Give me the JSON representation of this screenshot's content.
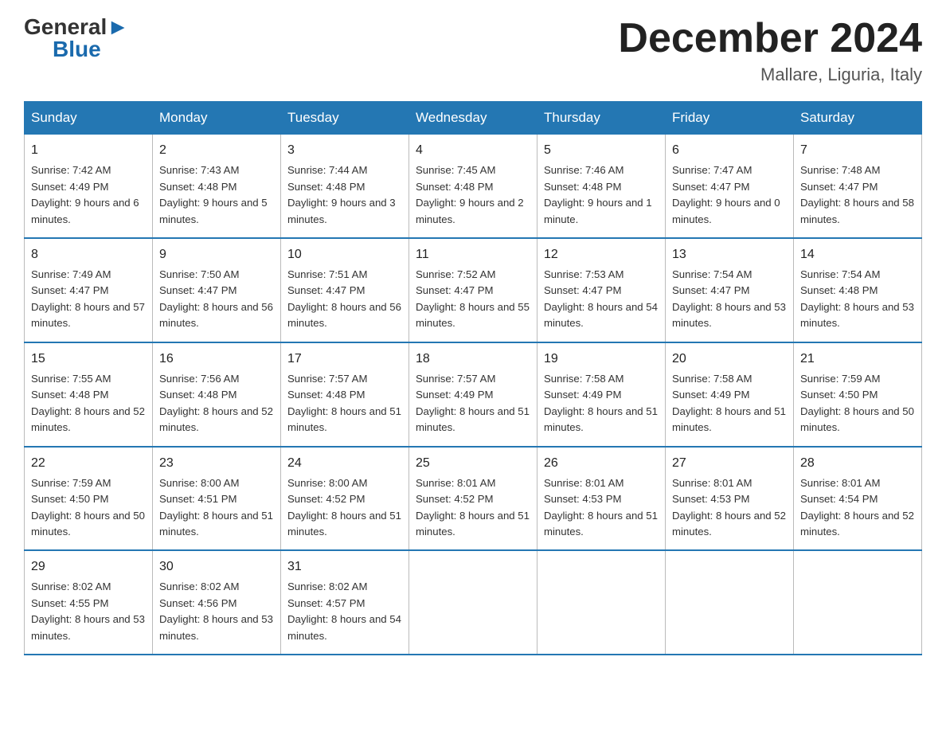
{
  "header": {
    "logo_general": "General",
    "logo_blue": "Blue",
    "month_title": "December 2024",
    "location": "Mallare, Liguria, Italy"
  },
  "days_of_week": [
    "Sunday",
    "Monday",
    "Tuesday",
    "Wednesday",
    "Thursday",
    "Friday",
    "Saturday"
  ],
  "weeks": [
    [
      {
        "day": "1",
        "sunrise": "7:42 AM",
        "sunset": "4:49 PM",
        "daylight": "9 hours and 6 minutes."
      },
      {
        "day": "2",
        "sunrise": "7:43 AM",
        "sunset": "4:48 PM",
        "daylight": "9 hours and 5 minutes."
      },
      {
        "day": "3",
        "sunrise": "7:44 AM",
        "sunset": "4:48 PM",
        "daylight": "9 hours and 3 minutes."
      },
      {
        "day": "4",
        "sunrise": "7:45 AM",
        "sunset": "4:48 PM",
        "daylight": "9 hours and 2 minutes."
      },
      {
        "day": "5",
        "sunrise": "7:46 AM",
        "sunset": "4:48 PM",
        "daylight": "9 hours and 1 minute."
      },
      {
        "day": "6",
        "sunrise": "7:47 AM",
        "sunset": "4:47 PM",
        "daylight": "9 hours and 0 minutes."
      },
      {
        "day": "7",
        "sunrise": "7:48 AM",
        "sunset": "4:47 PM",
        "daylight": "8 hours and 58 minutes."
      }
    ],
    [
      {
        "day": "8",
        "sunrise": "7:49 AM",
        "sunset": "4:47 PM",
        "daylight": "8 hours and 57 minutes."
      },
      {
        "day": "9",
        "sunrise": "7:50 AM",
        "sunset": "4:47 PM",
        "daylight": "8 hours and 56 minutes."
      },
      {
        "day": "10",
        "sunrise": "7:51 AM",
        "sunset": "4:47 PM",
        "daylight": "8 hours and 56 minutes."
      },
      {
        "day": "11",
        "sunrise": "7:52 AM",
        "sunset": "4:47 PM",
        "daylight": "8 hours and 55 minutes."
      },
      {
        "day": "12",
        "sunrise": "7:53 AM",
        "sunset": "4:47 PM",
        "daylight": "8 hours and 54 minutes."
      },
      {
        "day": "13",
        "sunrise": "7:54 AM",
        "sunset": "4:47 PM",
        "daylight": "8 hours and 53 minutes."
      },
      {
        "day": "14",
        "sunrise": "7:54 AM",
        "sunset": "4:48 PM",
        "daylight": "8 hours and 53 minutes."
      }
    ],
    [
      {
        "day": "15",
        "sunrise": "7:55 AM",
        "sunset": "4:48 PM",
        "daylight": "8 hours and 52 minutes."
      },
      {
        "day": "16",
        "sunrise": "7:56 AM",
        "sunset": "4:48 PM",
        "daylight": "8 hours and 52 minutes."
      },
      {
        "day": "17",
        "sunrise": "7:57 AM",
        "sunset": "4:48 PM",
        "daylight": "8 hours and 51 minutes."
      },
      {
        "day": "18",
        "sunrise": "7:57 AM",
        "sunset": "4:49 PM",
        "daylight": "8 hours and 51 minutes."
      },
      {
        "day": "19",
        "sunrise": "7:58 AM",
        "sunset": "4:49 PM",
        "daylight": "8 hours and 51 minutes."
      },
      {
        "day": "20",
        "sunrise": "7:58 AM",
        "sunset": "4:49 PM",
        "daylight": "8 hours and 51 minutes."
      },
      {
        "day": "21",
        "sunrise": "7:59 AM",
        "sunset": "4:50 PM",
        "daylight": "8 hours and 50 minutes."
      }
    ],
    [
      {
        "day": "22",
        "sunrise": "7:59 AM",
        "sunset": "4:50 PM",
        "daylight": "8 hours and 50 minutes."
      },
      {
        "day": "23",
        "sunrise": "8:00 AM",
        "sunset": "4:51 PM",
        "daylight": "8 hours and 51 minutes."
      },
      {
        "day": "24",
        "sunrise": "8:00 AM",
        "sunset": "4:52 PM",
        "daylight": "8 hours and 51 minutes."
      },
      {
        "day": "25",
        "sunrise": "8:01 AM",
        "sunset": "4:52 PM",
        "daylight": "8 hours and 51 minutes."
      },
      {
        "day": "26",
        "sunrise": "8:01 AM",
        "sunset": "4:53 PM",
        "daylight": "8 hours and 51 minutes."
      },
      {
        "day": "27",
        "sunrise": "8:01 AM",
        "sunset": "4:53 PM",
        "daylight": "8 hours and 52 minutes."
      },
      {
        "day": "28",
        "sunrise": "8:01 AM",
        "sunset": "4:54 PM",
        "daylight": "8 hours and 52 minutes."
      }
    ],
    [
      {
        "day": "29",
        "sunrise": "8:02 AM",
        "sunset": "4:55 PM",
        "daylight": "8 hours and 53 minutes."
      },
      {
        "day": "30",
        "sunrise": "8:02 AM",
        "sunset": "4:56 PM",
        "daylight": "8 hours and 53 minutes."
      },
      {
        "day": "31",
        "sunrise": "8:02 AM",
        "sunset": "4:57 PM",
        "daylight": "8 hours and 54 minutes."
      },
      null,
      null,
      null,
      null
    ]
  ]
}
